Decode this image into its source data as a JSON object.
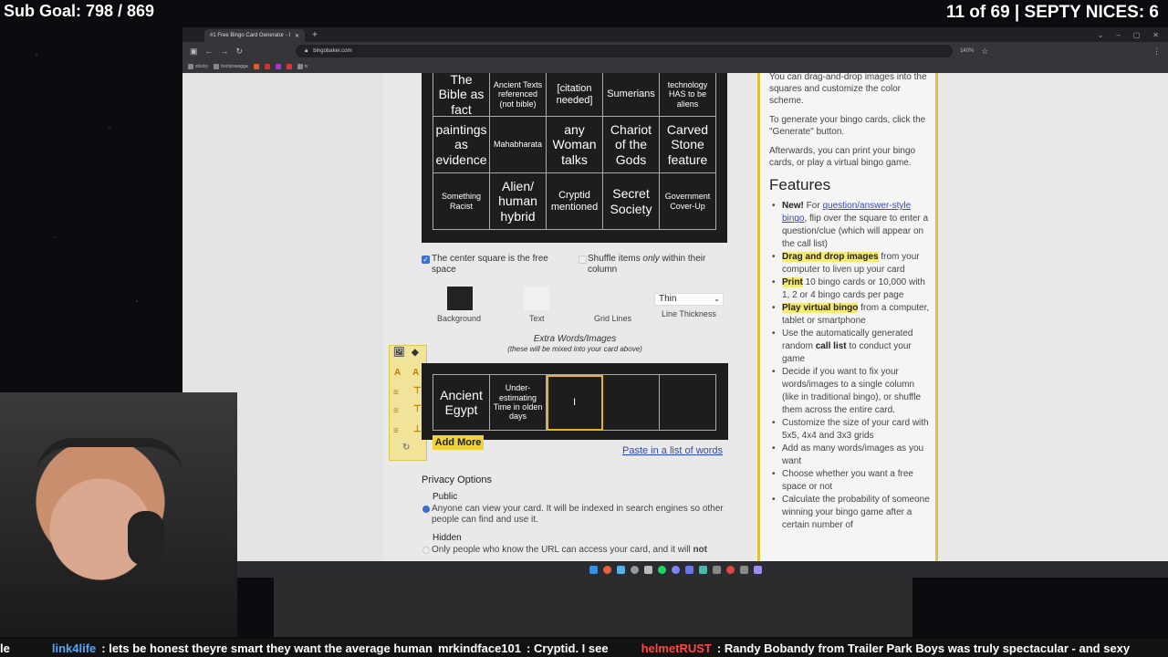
{
  "overlay": {
    "sub_goal": "Sub Goal: 798 / 869",
    "counter": "11 of 69 | SEPTY NICES: 6"
  },
  "browser": {
    "tab_title": "#1 Free Bingo Card Generator - I",
    "url": "bingobaker.com",
    "zoom": "140%",
    "bookmarks": [
      "stocky",
      "bootyswagga",
      "",
      "",
      "",
      "",
      "tv"
    ]
  },
  "bingo": {
    "rows": [
      [
        "The Bible as fact",
        "Ancient Texts referenced (not bible)",
        "[citation needed]",
        "Sumerians",
        "technology HAS to be aliens"
      ],
      [
        "paintings as evidence",
        "Mahabharata",
        "any Woman talks",
        "Chariot of the Gods",
        "Carved Stone feature"
      ],
      [
        "Something Racist",
        "Alien/ human hybrid",
        "Cryptid mentioned",
        "Secret Society",
        "Government Cover-Up"
      ]
    ]
  },
  "options": {
    "free_space_label": "The center square is the free space",
    "free_space_checked": true,
    "shuffle_label_a": "Shuffle items ",
    "shuffle_label_only": "only",
    "shuffle_label_b": " within their column",
    "background_label": "Background",
    "text_label": "Text",
    "gridlines_label": "Grid Lines",
    "line_thickness_value": "Thin",
    "line_thickness_label": "Line Thickness",
    "background_color": "#222222",
    "text_color": "#f5f5f5"
  },
  "extra": {
    "title": "Extra Words/Images",
    "subtitle": "(these will be mixed into your card above)",
    "cells": [
      "Ancient Egypt",
      "Under-estimating Time in olden days",
      "I",
      "",
      ""
    ],
    "add_more": "Add More",
    "paste": "Paste in a list of words"
  },
  "privacy": {
    "heading": "Privacy Options",
    "public_title": "Public",
    "public_desc": "Anyone can view your card. It will be indexed in search engines so other people can find and use it.",
    "hidden_title": "Hidden",
    "hidden_desc_a": "Only people who know the URL can access your card, and it will ",
    "hidden_desc_b": "not"
  },
  "sidebar": {
    "p1": "You can drag-and-drop images into the squares and customize the color scheme.",
    "p2": "To generate your bingo cards, click the \"Generate\" button.",
    "p3": "Afterwards, you can print your bingo cards, or play a virtual bingo game.",
    "features_heading": "Features",
    "f1_new": "New!",
    "f1_a": " For ",
    "f1_link": "question/answer-style bingo",
    "f1_b": ", flip over the square to enter a question/clue (which will appear on the call list)",
    "f2_hl": "Drag and drop images",
    "f2_rest": " from your computer to liven up your card",
    "f3_hl": "Print",
    "f3_rest": " 10 bingo cards or 10,000 with 1, 2 or 4 bingo cards per page",
    "f4_hl": "Play virtual bingo",
    "f4_rest": " from a computer, tablet or smartphone",
    "f5_a": "Use the automatically generated random ",
    "f5_b": "call list",
    "f5_c": " to conduct your game",
    "f6": "Decide if you want to fix your words/images to a single column (like in traditional bingo), or shuffle them across the entire card.",
    "f7": "Customize the size of your card with 5x5, 4x4 and 3x3 grids",
    "f8": "Add as many words/images as you want",
    "f9": "Choose whether you want a free space or not",
    "f10": "Calculate the probability of someone winning your bingo game after a certain number of"
  },
  "ticker": {
    "m0": "le",
    "u1": "link4life",
    "t1": ": lets be honest theyre smart they want the average human",
    "u2": "mrkindface101",
    "t2": ": Cryptid. I see",
    "u3": "helmetRUST",
    "t3": ": Randy Bobandy from Trailer Park Boys was truly spectacular - and sexy"
  }
}
